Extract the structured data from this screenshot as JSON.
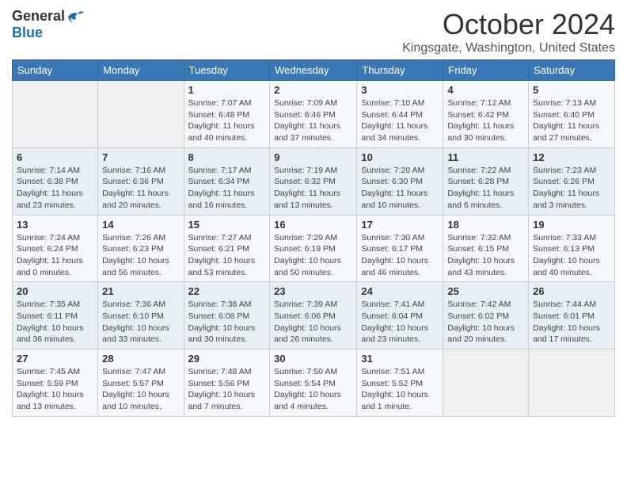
{
  "logo": {
    "general": "General",
    "blue": "Blue"
  },
  "title": "October 2024",
  "location": "Kingsgate, Washington, United States",
  "headers": [
    "Sunday",
    "Monday",
    "Tuesday",
    "Wednesday",
    "Thursday",
    "Friday",
    "Saturday"
  ],
  "weeks": [
    [
      {
        "day": "",
        "info": ""
      },
      {
        "day": "",
        "info": ""
      },
      {
        "day": "1",
        "info": "Sunrise: 7:07 AM\nSunset: 6:48 PM\nDaylight: 11 hours and 40 minutes."
      },
      {
        "day": "2",
        "info": "Sunrise: 7:09 AM\nSunset: 6:46 PM\nDaylight: 11 hours and 37 minutes."
      },
      {
        "day": "3",
        "info": "Sunrise: 7:10 AM\nSunset: 6:44 PM\nDaylight: 11 hours and 34 minutes."
      },
      {
        "day": "4",
        "info": "Sunrise: 7:12 AM\nSunset: 6:42 PM\nDaylight: 11 hours and 30 minutes."
      },
      {
        "day": "5",
        "info": "Sunrise: 7:13 AM\nSunset: 6:40 PM\nDaylight: 11 hours and 27 minutes."
      }
    ],
    [
      {
        "day": "6",
        "info": "Sunrise: 7:14 AM\nSunset: 6:38 PM\nDaylight: 11 hours and 23 minutes."
      },
      {
        "day": "7",
        "info": "Sunrise: 7:16 AM\nSunset: 6:36 PM\nDaylight: 11 hours and 20 minutes."
      },
      {
        "day": "8",
        "info": "Sunrise: 7:17 AM\nSunset: 6:34 PM\nDaylight: 11 hours and 16 minutes."
      },
      {
        "day": "9",
        "info": "Sunrise: 7:19 AM\nSunset: 6:32 PM\nDaylight: 11 hours and 13 minutes."
      },
      {
        "day": "10",
        "info": "Sunrise: 7:20 AM\nSunset: 6:30 PM\nDaylight: 11 hours and 10 minutes."
      },
      {
        "day": "11",
        "info": "Sunrise: 7:22 AM\nSunset: 6:28 PM\nDaylight: 11 hours and 6 minutes."
      },
      {
        "day": "12",
        "info": "Sunrise: 7:23 AM\nSunset: 6:26 PM\nDaylight: 11 hours and 3 minutes."
      }
    ],
    [
      {
        "day": "13",
        "info": "Sunrise: 7:24 AM\nSunset: 6:24 PM\nDaylight: 11 hours and 0 minutes."
      },
      {
        "day": "14",
        "info": "Sunrise: 7:26 AM\nSunset: 6:23 PM\nDaylight: 10 hours and 56 minutes."
      },
      {
        "day": "15",
        "info": "Sunrise: 7:27 AM\nSunset: 6:21 PM\nDaylight: 10 hours and 53 minutes."
      },
      {
        "day": "16",
        "info": "Sunrise: 7:29 AM\nSunset: 6:19 PM\nDaylight: 10 hours and 50 minutes."
      },
      {
        "day": "17",
        "info": "Sunrise: 7:30 AM\nSunset: 6:17 PM\nDaylight: 10 hours and 46 minutes."
      },
      {
        "day": "18",
        "info": "Sunrise: 7:32 AM\nSunset: 6:15 PM\nDaylight: 10 hours and 43 minutes."
      },
      {
        "day": "19",
        "info": "Sunrise: 7:33 AM\nSunset: 6:13 PM\nDaylight: 10 hours and 40 minutes."
      }
    ],
    [
      {
        "day": "20",
        "info": "Sunrise: 7:35 AM\nSunset: 6:11 PM\nDaylight: 10 hours and 36 minutes."
      },
      {
        "day": "21",
        "info": "Sunrise: 7:36 AM\nSunset: 6:10 PM\nDaylight: 10 hours and 33 minutes."
      },
      {
        "day": "22",
        "info": "Sunrise: 7:38 AM\nSunset: 6:08 PM\nDaylight: 10 hours and 30 minutes."
      },
      {
        "day": "23",
        "info": "Sunrise: 7:39 AM\nSunset: 6:06 PM\nDaylight: 10 hours and 26 minutes."
      },
      {
        "day": "24",
        "info": "Sunrise: 7:41 AM\nSunset: 6:04 PM\nDaylight: 10 hours and 23 minutes."
      },
      {
        "day": "25",
        "info": "Sunrise: 7:42 AM\nSunset: 6:02 PM\nDaylight: 10 hours and 20 minutes."
      },
      {
        "day": "26",
        "info": "Sunrise: 7:44 AM\nSunset: 6:01 PM\nDaylight: 10 hours and 17 minutes."
      }
    ],
    [
      {
        "day": "27",
        "info": "Sunrise: 7:45 AM\nSunset: 5:59 PM\nDaylight: 10 hours and 13 minutes."
      },
      {
        "day": "28",
        "info": "Sunrise: 7:47 AM\nSunset: 5:57 PM\nDaylight: 10 hours and 10 minutes."
      },
      {
        "day": "29",
        "info": "Sunrise: 7:48 AM\nSunset: 5:56 PM\nDaylight: 10 hours and 7 minutes."
      },
      {
        "day": "30",
        "info": "Sunrise: 7:50 AM\nSunset: 5:54 PM\nDaylight: 10 hours and 4 minutes."
      },
      {
        "day": "31",
        "info": "Sunrise: 7:51 AM\nSunset: 5:52 PM\nDaylight: 10 hours and 1 minute."
      },
      {
        "day": "",
        "info": ""
      },
      {
        "day": "",
        "info": ""
      }
    ]
  ]
}
